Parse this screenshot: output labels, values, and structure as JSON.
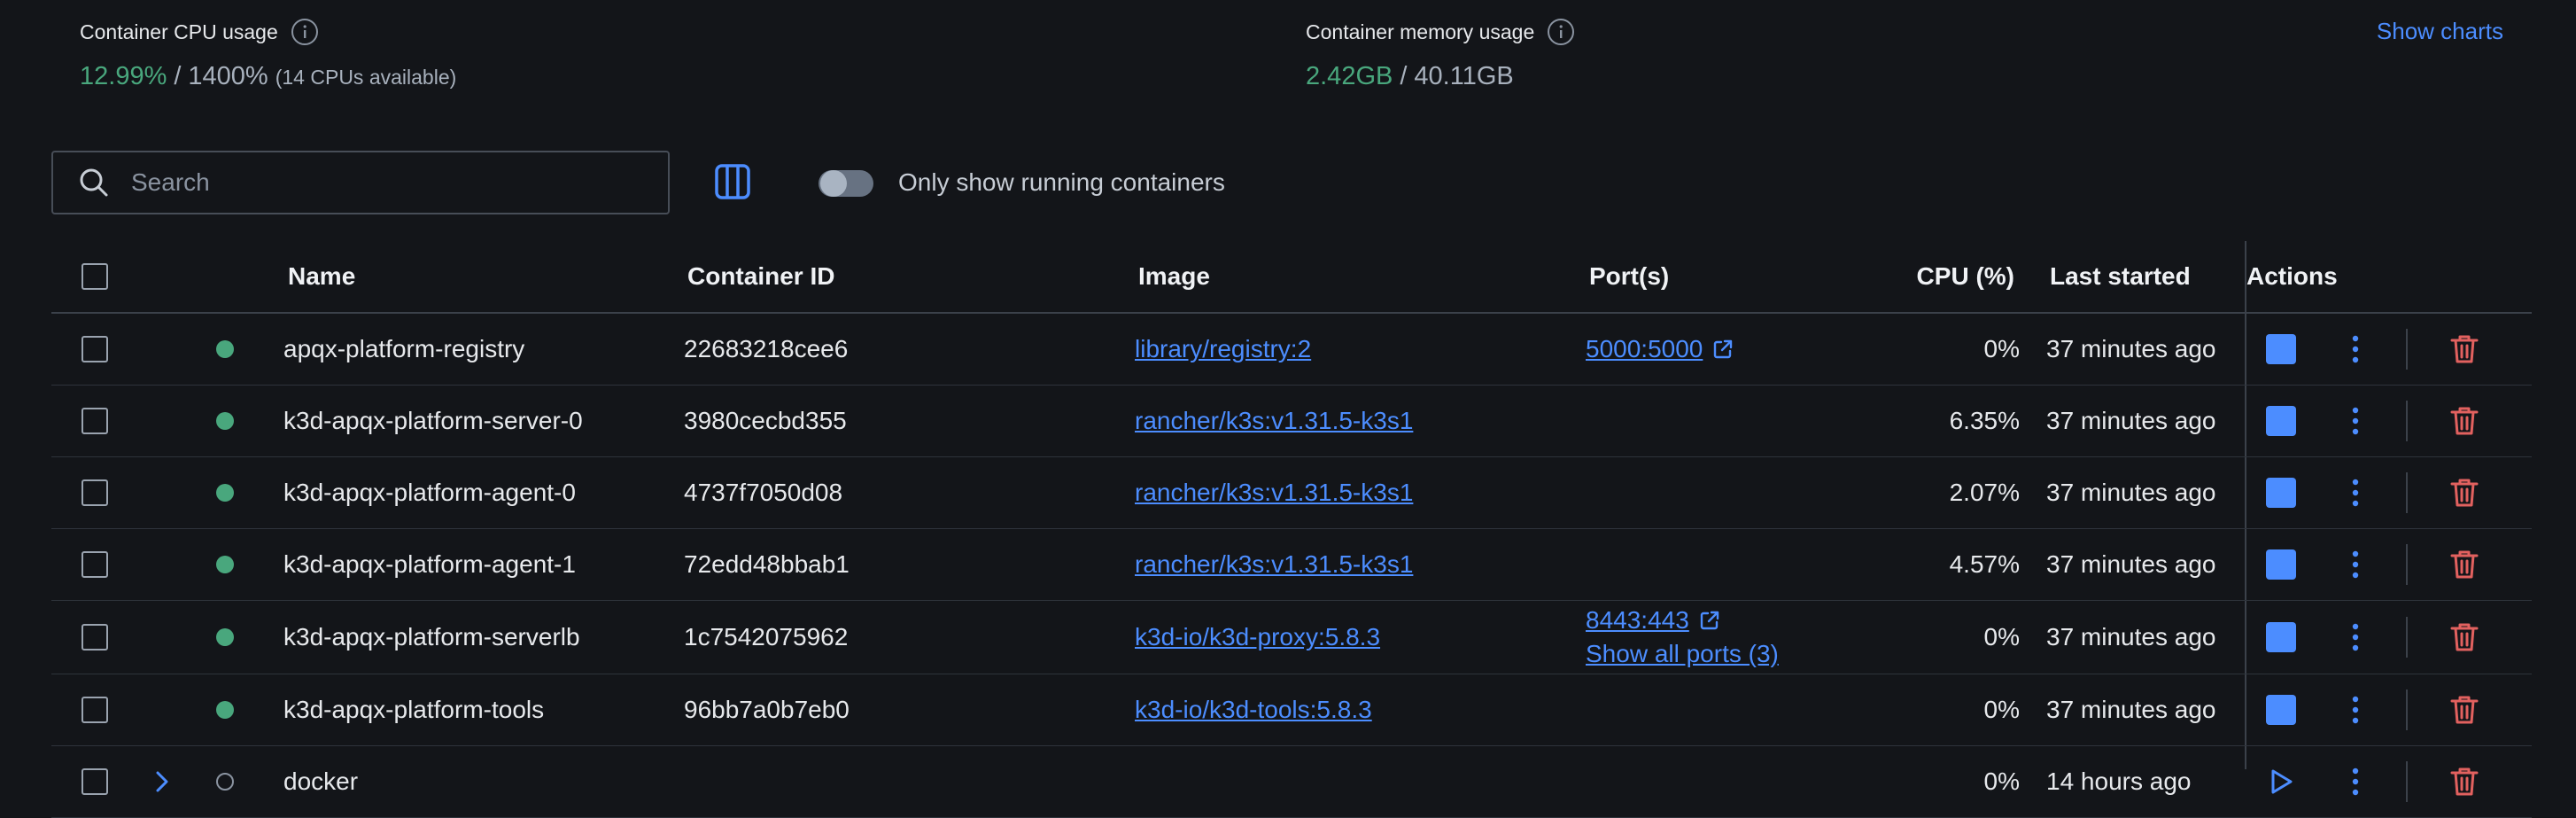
{
  "stats": {
    "cpu": {
      "title": "Container CPU usage",
      "used": "12.99%",
      "separator": "/",
      "total": "1400%",
      "note": "(14 CPUs available)"
    },
    "memory": {
      "title": "Container memory usage",
      "used": "2.42GB",
      "separator": "/",
      "total": "40.11GB"
    },
    "show_charts_label": "Show charts"
  },
  "toolbar": {
    "search_placeholder": "Search",
    "running_only_label": "Only show running containers",
    "running_only_enabled": false
  },
  "table": {
    "headers": {
      "name": "Name",
      "container_id": "Container ID",
      "image": "Image",
      "ports": "Port(s)",
      "cpu": "CPU (%)",
      "last_started": "Last started",
      "actions": "Actions"
    },
    "rows": [
      {
        "name": "apqx-platform-registry",
        "container_id": "22683218cee6",
        "image": "library/registry:2",
        "port": "5000:5000",
        "cpu": "0%",
        "last_started": "37 minutes ago",
        "status": "running"
      },
      {
        "name": "k3d-apqx-platform-server-0",
        "container_id": "3980cecbd355",
        "image": "rancher/k3s:v1.31.5-k3s1",
        "port": "",
        "cpu": "6.35%",
        "last_started": "37 minutes ago",
        "status": "running"
      },
      {
        "name": "k3d-apqx-platform-agent-0",
        "container_id": "4737f7050d08",
        "image": "rancher/k3s:v1.31.5-k3s1",
        "port": "",
        "cpu": "2.07%",
        "last_started": "37 minutes ago",
        "status": "running"
      },
      {
        "name": "k3d-apqx-platform-agent-1",
        "container_id": "72edd48bbab1",
        "image": "rancher/k3s:v1.31.5-k3s1",
        "port": "",
        "cpu": "4.57%",
        "last_started": "37 minutes ago",
        "status": "running"
      },
      {
        "name": "k3d-apqx-platform-serverlb",
        "container_id": "1c7542075962",
        "image": "k3d-io/k3d-proxy:5.8.3",
        "port": "8443:443",
        "show_all_ports": "Show all ports (3)",
        "cpu": "0%",
        "last_started": "37 minutes ago",
        "status": "running"
      },
      {
        "name": "k3d-apqx-platform-tools",
        "container_id": "96bb7a0b7eb0",
        "image": "k3d-io/k3d-tools:5.8.3",
        "port": "",
        "cpu": "0%",
        "last_started": "37 minutes ago",
        "status": "running"
      },
      {
        "name": "docker",
        "container_id": "",
        "image": "",
        "port": "",
        "cpu": "0%",
        "last_started": "14 hours ago",
        "status": "stopped"
      }
    ]
  },
  "colors": {
    "background": "#131519",
    "accent": "#4c8dff",
    "running": "#49a77d",
    "delete": "#e2615f"
  },
  "icons": {
    "info": "info-icon",
    "search": "search-icon",
    "columns": "columns-icon",
    "external_link": "external-link-icon",
    "stop": "stop-icon",
    "more": "more-vertical-icon",
    "delete": "trash-icon",
    "play": "play-icon",
    "expand": "chevron-right-icon"
  }
}
